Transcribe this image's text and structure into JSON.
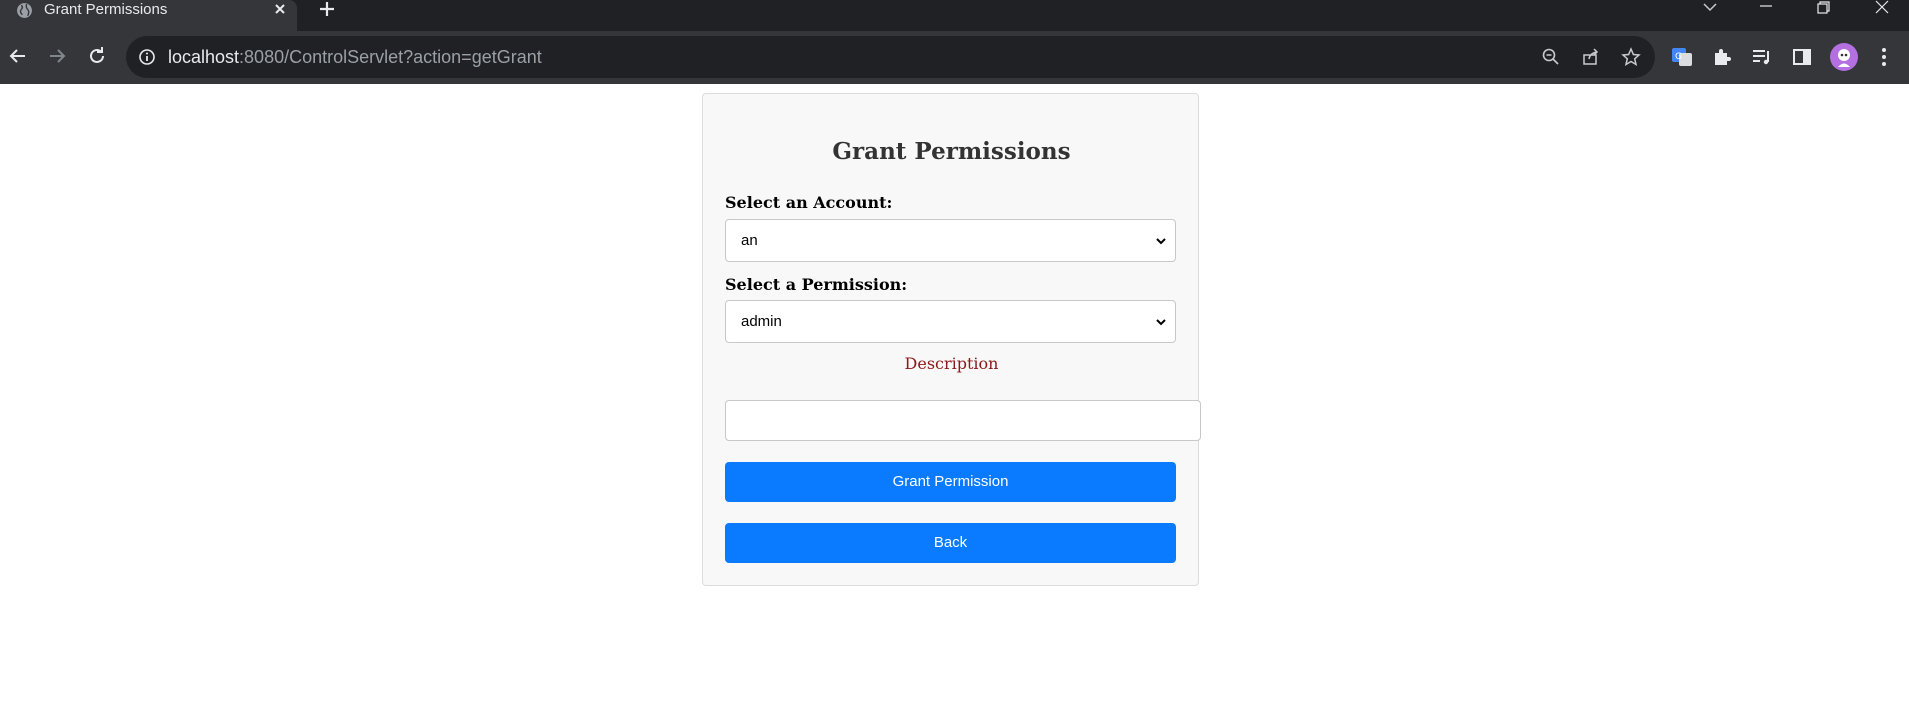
{
  "browser": {
    "tab_title": "Grant Permissions",
    "url_host": "localhost",
    "url_rest": ":8080/ControlServlet?action=getGrant"
  },
  "form": {
    "heading": "Grant Permissions",
    "account_label": "Select an Account:",
    "account_value": "an",
    "permission_label": "Select a Permission:",
    "permission_value": "admin",
    "description_label": "Description",
    "description_value": "",
    "grant_button": "Grant Permission",
    "back_button": "Back"
  },
  "colors": {
    "button": "#0a7bff",
    "description_label": "#8b1a1a",
    "card_background": "#f8f8f8"
  }
}
